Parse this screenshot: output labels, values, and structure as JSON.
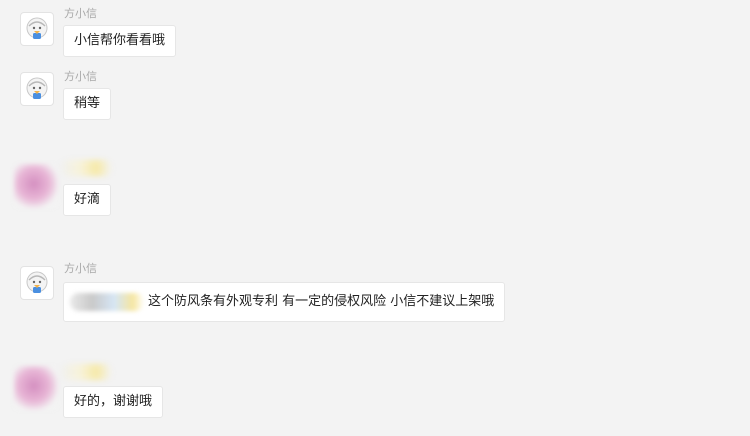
{
  "messages": [
    {
      "sender": "方小信",
      "avatar": "bot-avatar",
      "text": "小信帮你看看哦"
    },
    {
      "sender": "方小信",
      "avatar": "bot-avatar",
      "text": "稍等"
    },
    {
      "sender": "",
      "avatar": "user-avatar-blurred",
      "text": "好滴"
    },
    {
      "sender": "方小信",
      "avatar": "bot-avatar",
      "text": "这个防风条有外观专利 有一定的侵权风险 小信不建议上架哦"
    },
    {
      "sender": "",
      "avatar": "user-avatar-blurred",
      "text": "好的，谢谢哦"
    }
  ]
}
